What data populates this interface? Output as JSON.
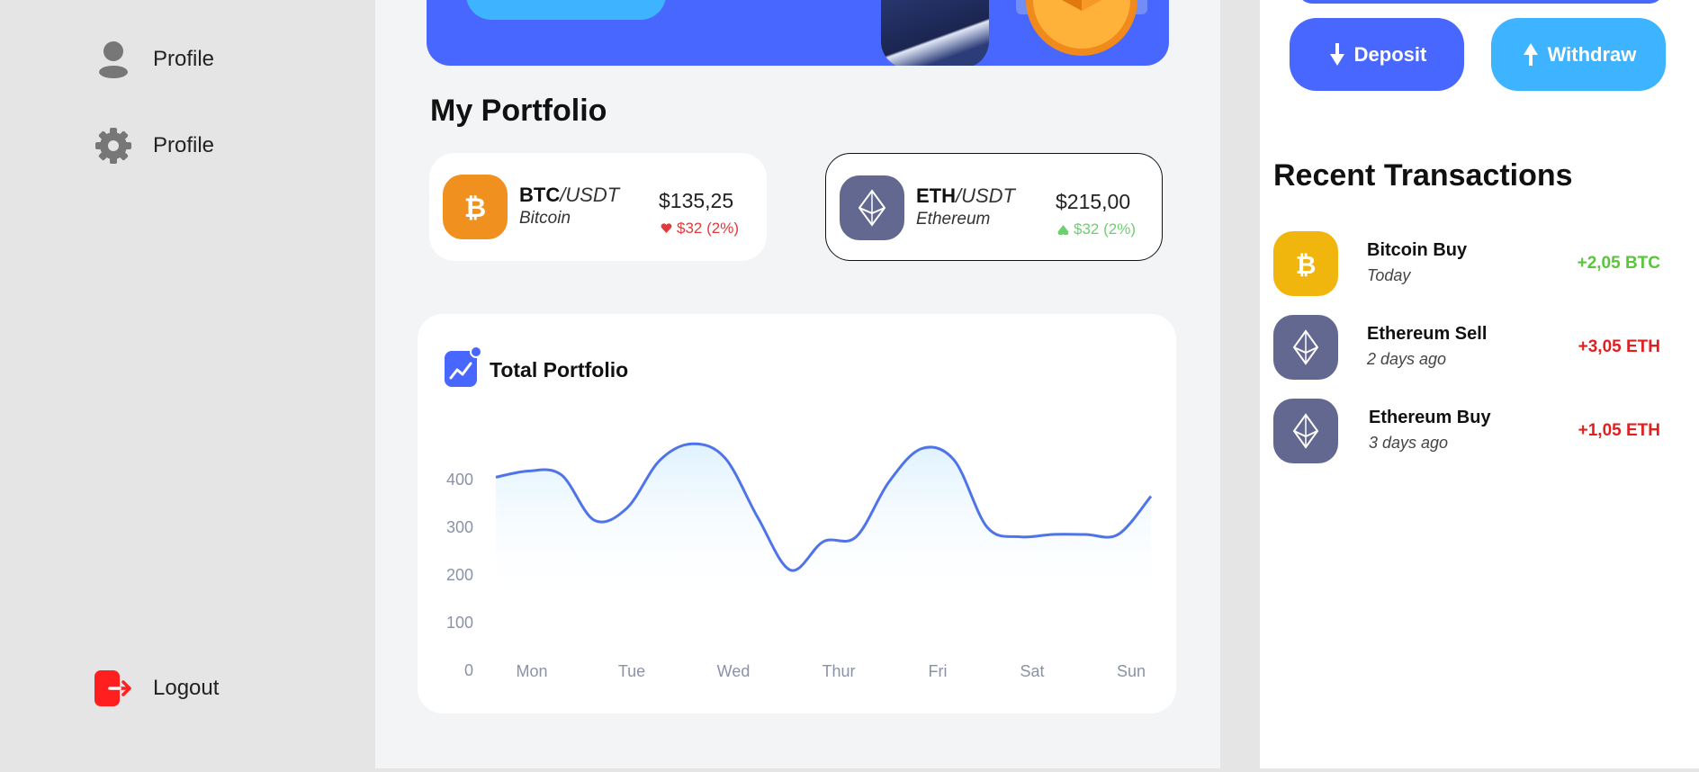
{
  "sidebar": {
    "items": [
      {
        "label": "Profile",
        "icon": "user-icon"
      },
      {
        "label": "Profile",
        "icon": "gear-icon"
      }
    ],
    "logout": {
      "label": "Logout",
      "icon": "logout-icon",
      "color": "#ff1f1f"
    }
  },
  "portfolio": {
    "title": "My Portfolio",
    "cards": [
      {
        "symbol": "BTC",
        "quote": "/USDT",
        "name": "Bitcoin",
        "price": "$135,25",
        "change": "$32 (2%)",
        "direction": "down",
        "color": "#f0901e",
        "change_color": "#e23a3a"
      },
      {
        "symbol": "ETH",
        "quote": "/USDT",
        "name": "Ethereum",
        "price": "$215,00",
        "change": "$32 (2%)",
        "direction": "up",
        "color": "#62688f",
        "change_color": "#6fce6f"
      }
    ]
  },
  "chart": {
    "title": "Total Portfolio"
  },
  "chart_data": {
    "type": "area",
    "title": "Total Portfolio",
    "categories": [
      "Mon",
      "Tue",
      "Wed",
      "Thur",
      "Fri",
      "Sat",
      "Sun"
    ],
    "x": [
      "",
      "",
      "Mon",
      "",
      "",
      "Tue",
      "",
      "",
      "Wed",
      "",
      "",
      "Thur",
      "",
      "",
      "Fri",
      "",
      "",
      "Sat",
      "",
      "Sun",
      "Sun+"
    ],
    "series": [
      {
        "values": [
          405,
          418,
          410,
          315,
          340,
          440,
          475,
          445,
          320,
          210,
          270,
          280,
          395,
          465,
          440,
          300,
          280,
          285,
          285,
          285,
          365
        ]
      }
    ],
    "yticks": [
      0,
      100,
      200,
      300,
      400
    ],
    "ylim": [
      0,
      500
    ],
    "line_color": "#4f74ea",
    "fill_color": "#dff2ff"
  },
  "actions": {
    "deposit": {
      "label": "Deposit",
      "color": "#4767ff"
    },
    "withdraw": {
      "label": "Withdraw",
      "color": "#3eb3ff"
    }
  },
  "transactions": {
    "title": "Recent Transactions",
    "items": [
      {
        "name": "Bitcoin Buy",
        "date": "Today",
        "amount": "+2,05 BTC",
        "coin": "btc",
        "color": "#f0b60e",
        "amount_color": "#59c63c"
      },
      {
        "name": "Ethereum Sell",
        "date": "2 days ago",
        "amount": "+3,05 ETH",
        "coin": "eth",
        "color": "#62688f",
        "amount_color": "#e01f1f"
      },
      {
        "name": "Ethereum Buy",
        "date": "3 days ago",
        "amount": "+1,05 ETH",
        "coin": "eth",
        "color": "#62688f",
        "amount_color": "#e01f1f"
      }
    ]
  }
}
